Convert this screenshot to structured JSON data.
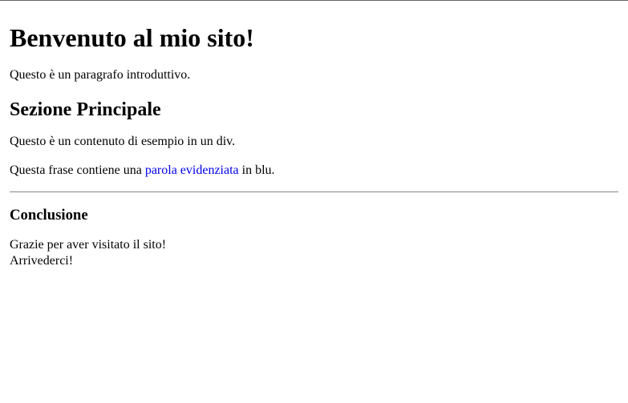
{
  "heading1": "Benvenuto al mio sito!",
  "intro": "Questo è un paragrafo introduttivo.",
  "heading2": "Sezione Principale",
  "divContent": "Questo è un contenuto di esempio in un div.",
  "span_prefix": "Questa frase contiene una ",
  "span_highlight": "parola evidenziata",
  "span_suffix": " in blu.",
  "heading3": "Conclusione",
  "closing_line1": "Grazie per aver visitato il sito!",
  "closing_line2": "Arrivederci!"
}
